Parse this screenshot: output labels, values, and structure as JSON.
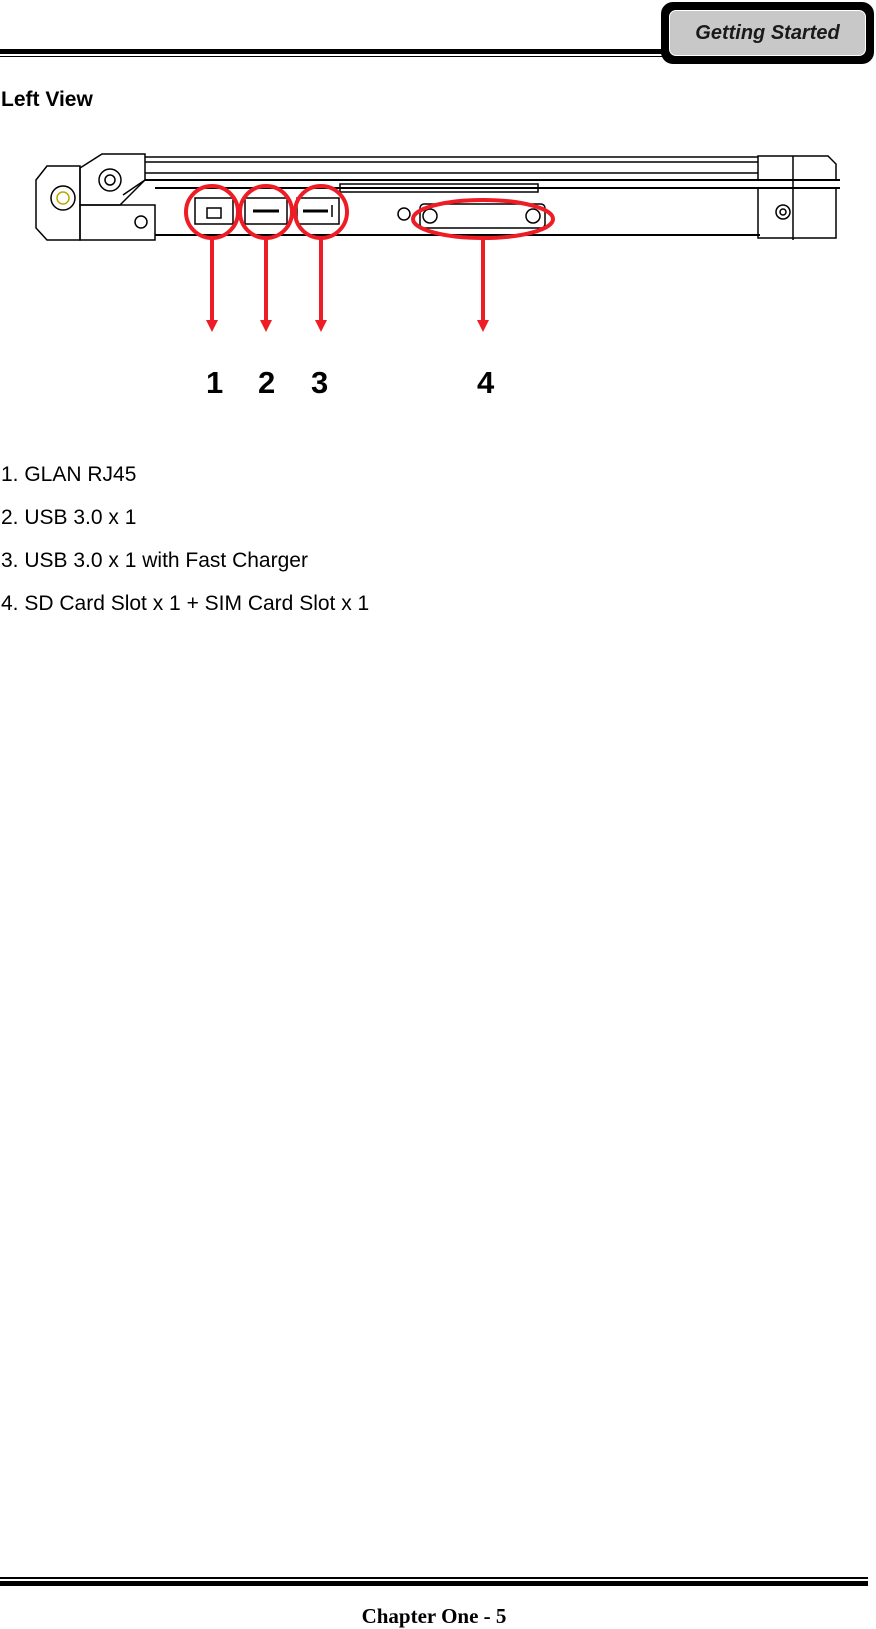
{
  "header": {
    "section_tab": "Getting Started"
  },
  "page": {
    "heading": "Left View"
  },
  "figure": {
    "description": "Laptop left side view with callouts",
    "callout_color": "#ee1c24",
    "callouts": [
      "1",
      "2",
      "3",
      "4"
    ],
    "port_icons": [
      "lan-port-icon",
      "usb-port-icon",
      "usb-charge-port-icon",
      "card-slot-cover-icon"
    ]
  },
  "spec_list": [
    "1. GLAN RJ45",
    "2. USB 3.0 x 1",
    "3. USB 3.0 x 1 with Fast Charger",
    "4. SD Card Slot x 1 + SIM Card Slot x 1"
  ],
  "footer": {
    "page_label": "Chapter One - 5"
  }
}
